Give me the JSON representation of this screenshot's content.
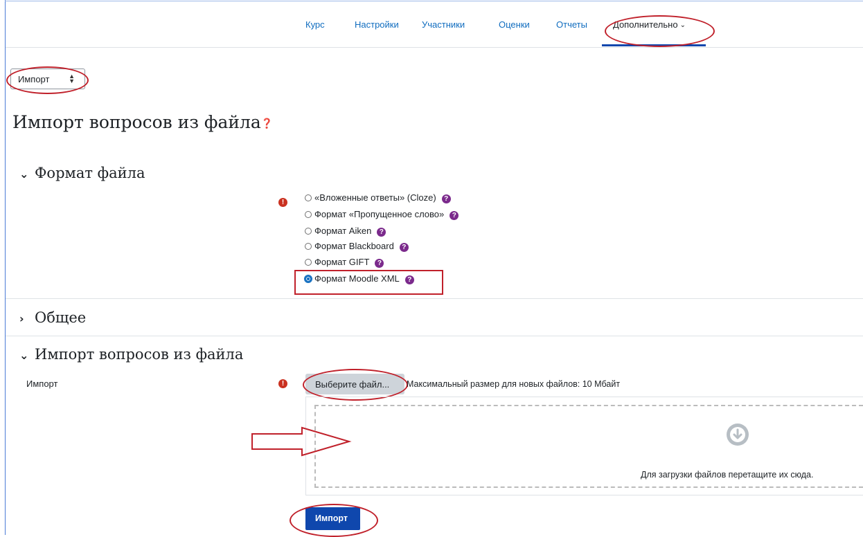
{
  "nav": {
    "items": [
      {
        "label": "Курс"
      },
      {
        "label": "Настройки"
      },
      {
        "label": "Участники"
      },
      {
        "label": "Оценки"
      },
      {
        "label": "Отчеты"
      },
      {
        "label": "Дополнительно"
      }
    ],
    "active": "Дополнительно"
  },
  "selector": {
    "value": "Импорт"
  },
  "page_title": "Импорт вопросов из файла",
  "sections": {
    "format": {
      "title": "Формат файла",
      "options": [
        {
          "label": "«Вложенные ответы» (Cloze)",
          "selected": false
        },
        {
          "label": "Формат «Пропущенное слово»",
          "selected": false
        },
        {
          "label": "Формат Aiken",
          "selected": false
        },
        {
          "label": "Формат Blackboard",
          "selected": false
        },
        {
          "label": "Формат GIFT",
          "selected": false
        },
        {
          "label": "Формат Moodle XML",
          "selected": true
        }
      ]
    },
    "general": {
      "title": "Общее"
    },
    "import_file": {
      "title": "Импорт вопросов из файла",
      "field_label": "Импорт",
      "choose_button": "Выберите файл...",
      "max_size": "Максимальный размер для новых файлов: 10 Мбайт",
      "drop_message": "Для загрузки файлов перетащите их сюда."
    }
  },
  "submit_label": "Импорт",
  "colors": {
    "accent": "#0f47ad",
    "link": "#0f6cbf",
    "error": "#ca3120",
    "help": "#7b2a8c",
    "annotation": "#c0202a"
  },
  "icons": {
    "error": "exclamation-circle-icon",
    "help": "question-circle-icon",
    "download": "arrow-down-circle-icon",
    "chevron": "chevron-down-icon"
  }
}
